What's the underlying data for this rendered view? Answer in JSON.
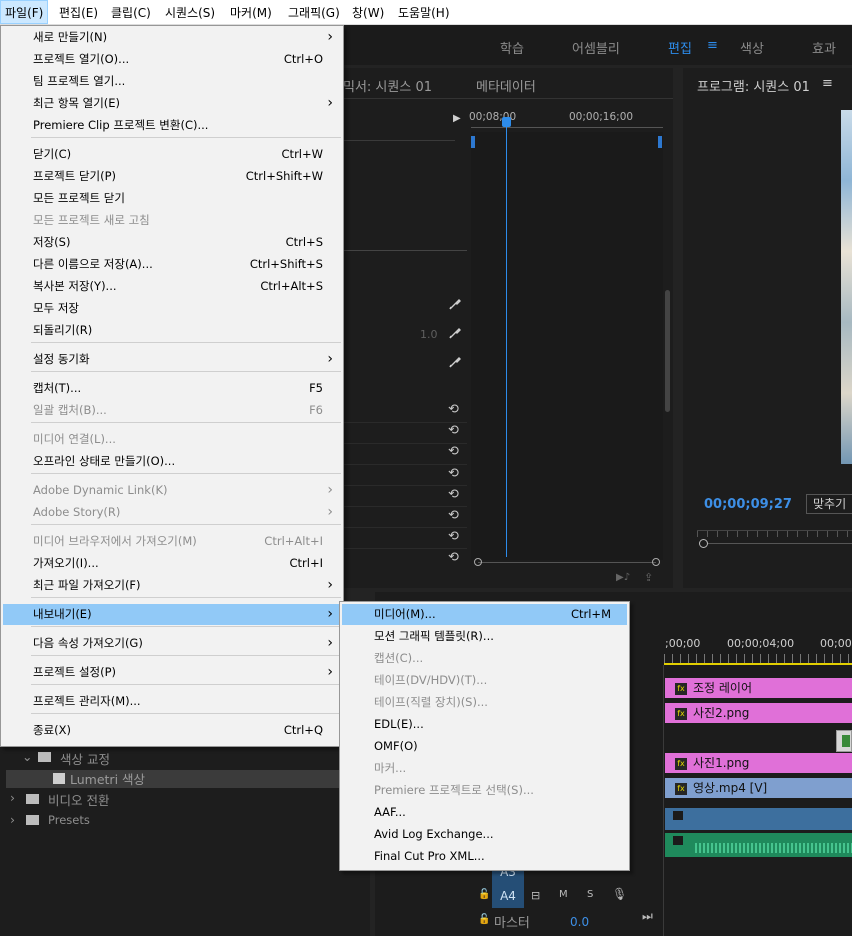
{
  "menubar": {
    "items": [
      "파일(F)",
      "편집(E)",
      "클립(C)",
      "시퀀스(S)",
      "마커(M)",
      "그래픽(G)",
      "창(W)",
      "도움말(H)"
    ]
  },
  "workspace": {
    "tabs": [
      "학습",
      "어셈블리",
      "편집",
      "색상",
      "효과"
    ],
    "active_index": 2,
    "edit_menu_icon": "≡"
  },
  "panels": {
    "source_title": "믹서: 시퀀스 01",
    "metadata_title": "메타데이터",
    "program_title": "프로그램: 시퀀스 01",
    "program_menu_icon": "≡",
    "source_time_1": "00;08;00",
    "source_time_2": "00;00;16;00",
    "value_1_0": "1.0",
    "program_timecode": "00;00;09;27",
    "fit_label": "맞추기",
    "timeline_time_0": ";00;00",
    "timeline_time_1": "00;00;04;00",
    "timeline_time_2": "00;00"
  },
  "project_tree": {
    "items": [
      {
        "label": "색상 교정"
      },
      {
        "label": "Lumetri 색상"
      },
      {
        "label": "비디오 전환"
      },
      {
        "label": "Presets"
      }
    ]
  },
  "timeline": {
    "clips": [
      {
        "label": "조정 레이어"
      },
      {
        "label": "사진2.png"
      },
      {
        "label": "사진1.png"
      },
      {
        "label": "영상.mp4 [V]"
      }
    ],
    "track_a3": "A3",
    "track_a4": "A4",
    "m_label": "M",
    "s_label": "S",
    "master_label": "마스터",
    "master_value": "0.0"
  },
  "file_menu": {
    "items": [
      {
        "label": "새로 만들기(N)",
        "shortcut": "",
        "submenu": true,
        "disabled": false
      },
      {
        "label": "프로젝트 열기(O)...",
        "shortcut": "Ctrl+O",
        "submenu": false,
        "disabled": false
      },
      {
        "label": "팀 프로젝트 열기...",
        "shortcut": "",
        "submenu": false,
        "disabled": false
      },
      {
        "label": "최근 항목 열기(E)",
        "shortcut": "",
        "submenu": true,
        "disabled": false
      },
      {
        "label": "Premiere Clip 프로젝트 변환(C)...",
        "shortcut": "",
        "submenu": false,
        "disabled": false
      },
      {
        "label": "닫기(C)",
        "shortcut": "Ctrl+W",
        "submenu": false,
        "disabled": false
      },
      {
        "label": "프로젝트 닫기(P)",
        "shortcut": "Ctrl+Shift+W",
        "submenu": false,
        "disabled": false
      },
      {
        "label": "모든 프로젝트 닫기",
        "shortcut": "",
        "submenu": false,
        "disabled": false
      },
      {
        "label": "모든 프로젝트 새로 고침",
        "shortcut": "",
        "submenu": false,
        "disabled": true
      },
      {
        "label": "저장(S)",
        "shortcut": "Ctrl+S",
        "submenu": false,
        "disabled": false
      },
      {
        "label": "다른 이름으로 저장(A)...",
        "shortcut": "Ctrl+Shift+S",
        "submenu": false,
        "disabled": false
      },
      {
        "label": "복사본 저장(Y)...",
        "shortcut": "Ctrl+Alt+S",
        "submenu": false,
        "disabled": false
      },
      {
        "label": "모두 저장",
        "shortcut": "",
        "submenu": false,
        "disabled": false
      },
      {
        "label": "되돌리기(R)",
        "shortcut": "",
        "submenu": false,
        "disabled": false
      },
      {
        "label": "설정 동기화",
        "shortcut": "",
        "submenu": true,
        "disabled": false
      },
      {
        "label": "캡처(T)...",
        "shortcut": "F5",
        "submenu": false,
        "disabled": false
      },
      {
        "label": "일괄 캡처(B)...",
        "shortcut": "F6",
        "submenu": false,
        "disabled": true
      },
      {
        "label": "미디어 연결(L)...",
        "shortcut": "",
        "submenu": false,
        "disabled": true
      },
      {
        "label": "오프라인 상태로 만들기(O)...",
        "shortcut": "",
        "submenu": false,
        "disabled": false
      },
      {
        "label": "Adobe Dynamic Link(K)",
        "shortcut": "",
        "submenu": true,
        "disabled": true
      },
      {
        "label": "Adobe Story(R)",
        "shortcut": "",
        "submenu": true,
        "disabled": true
      },
      {
        "label": "미디어 브라우저에서 가져오기(M)",
        "shortcut": "Ctrl+Alt+I",
        "submenu": false,
        "disabled": true
      },
      {
        "label": "가져오기(I)...",
        "shortcut": "Ctrl+I",
        "submenu": false,
        "disabled": false
      },
      {
        "label": "최근 파일 가져오기(F)",
        "shortcut": "",
        "submenu": true,
        "disabled": false
      },
      {
        "label": "내보내기(E)",
        "shortcut": "",
        "submenu": true,
        "disabled": false,
        "highlighted": true
      },
      {
        "label": "다음 속성 가져오기(G)",
        "shortcut": "",
        "submenu": true,
        "disabled": false
      },
      {
        "label": "프로젝트 설정(P)",
        "shortcut": "",
        "submenu": true,
        "disabled": false
      },
      {
        "label": "프로젝트 관리자(M)...",
        "shortcut": "",
        "submenu": false,
        "disabled": false
      },
      {
        "label": "종료(X)",
        "shortcut": "Ctrl+Q",
        "submenu": false,
        "disabled": false
      }
    ]
  },
  "export_menu": {
    "items": [
      {
        "label": "미디어(M)...",
        "shortcut": "Ctrl+M",
        "disabled": false,
        "highlighted": true
      },
      {
        "label": "모션 그래픽 템플릿(R)...",
        "shortcut": "",
        "disabled": false
      },
      {
        "label": "캡션(C)...",
        "shortcut": "",
        "disabled": true
      },
      {
        "label": "테이프(DV/HDV)(T)...",
        "shortcut": "",
        "disabled": true
      },
      {
        "label": "테이프(직렬 장치)(S)...",
        "shortcut": "",
        "disabled": true
      },
      {
        "label": "EDL(E)...",
        "shortcut": "",
        "disabled": false
      },
      {
        "label": "OMF(O)",
        "shortcut": "",
        "disabled": false
      },
      {
        "label": "마커...",
        "shortcut": "",
        "disabled": true
      },
      {
        "label": "Premiere 프로젝트로 선택(S)...",
        "shortcut": "",
        "disabled": true
      },
      {
        "label": "AAF...",
        "shortcut": "",
        "disabled": false
      },
      {
        "label": "Avid Log Exchange...",
        "shortcut": "",
        "disabled": false
      },
      {
        "label": "Final Cut Pro XML...",
        "shortcut": "",
        "disabled": false
      }
    ]
  },
  "colors": {
    "menu_highlight": "#91c9f7",
    "clip_pink": "#e070d8",
    "clip_blue": "#7f9fcf",
    "audio_green": "#2ea46c",
    "accent_blue": "#2d8ceb"
  }
}
